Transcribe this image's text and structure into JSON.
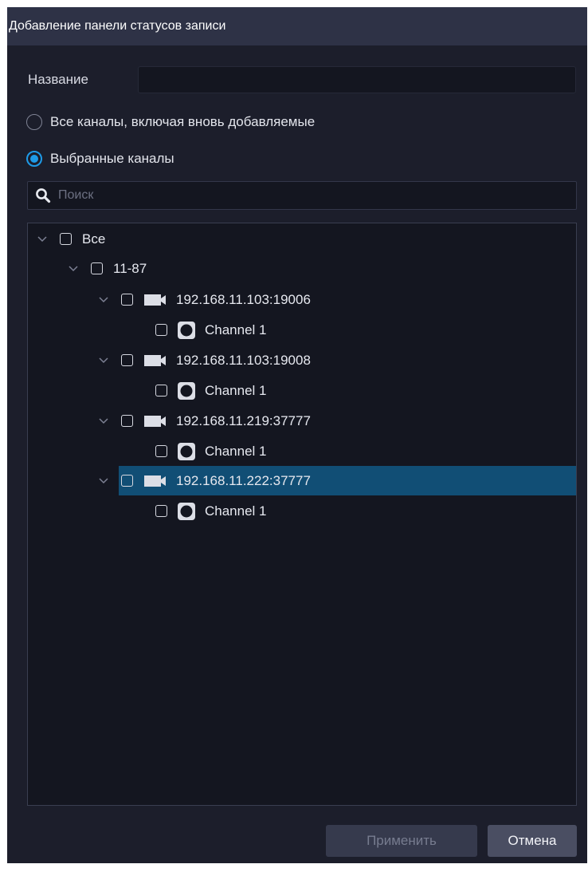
{
  "dialog": {
    "title": "Добавление панели статусов записи"
  },
  "form": {
    "name_label": "Название",
    "name_value": ""
  },
  "radios": [
    {
      "label": "Все каналы, включая вновь добавляемые",
      "checked": false
    },
    {
      "label": "Выбранные каналы",
      "checked": true
    }
  ],
  "search": {
    "placeholder": "Поиск",
    "icon": "search-icon"
  },
  "tree": {
    "root": {
      "label": "Все",
      "expanded": true,
      "checked": false
    },
    "group": {
      "label": "11-87",
      "expanded": true,
      "checked": false
    },
    "devices": [
      {
        "label": "192.168.11.103:19006",
        "icon": "camera-icon",
        "expanded": true,
        "checked": false,
        "selected": false,
        "channels": [
          {
            "label": "Channel 1",
            "icon": "channel-icon",
            "checked": false
          }
        ]
      },
      {
        "label": "192.168.11.103:19008",
        "icon": "camera-icon",
        "expanded": true,
        "checked": false,
        "selected": false,
        "channels": [
          {
            "label": "Channel 1",
            "icon": "channel-icon",
            "checked": false
          }
        ]
      },
      {
        "label": "192.168.11.219:37777",
        "icon": "camera-icon",
        "expanded": true,
        "checked": false,
        "selected": false,
        "channels": [
          {
            "label": "Channel 1",
            "icon": "channel-icon",
            "checked": false
          }
        ]
      },
      {
        "label": "192.168.11.222:37777",
        "icon": "camera-icon",
        "expanded": true,
        "checked": false,
        "selected": true,
        "channels": [
          {
            "label": "Channel 1",
            "icon": "channel-icon",
            "checked": false
          }
        ]
      }
    ]
  },
  "buttons": {
    "apply_label": "Применить",
    "apply_enabled": false,
    "cancel_label": "Отмена"
  },
  "colors": {
    "background": "#1c1e2b",
    "title_bar": "#2e3246",
    "accent": "#1e9be8",
    "selection": "#114e75"
  }
}
